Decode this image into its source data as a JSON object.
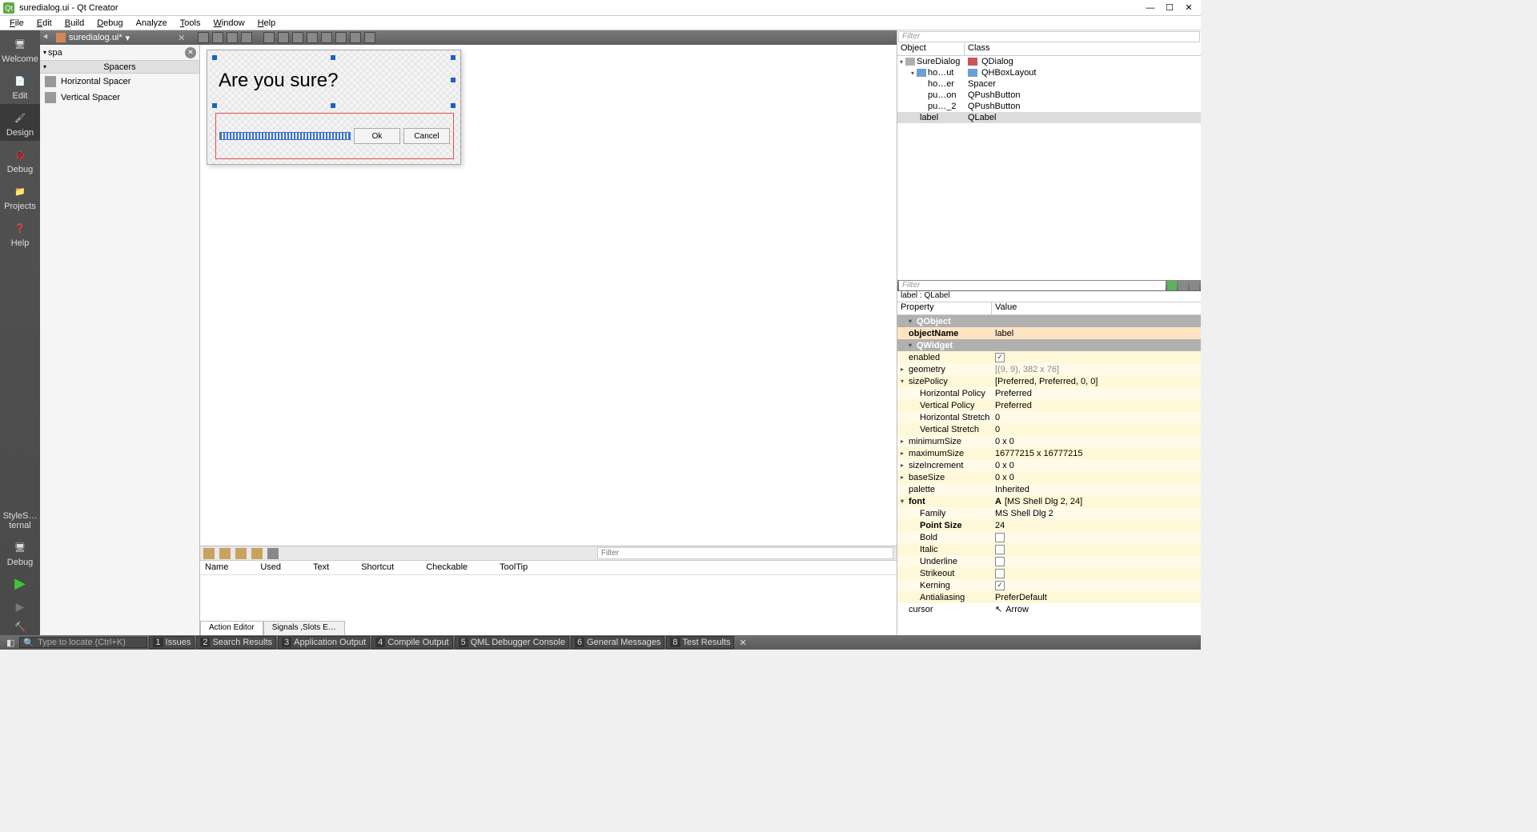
{
  "window": {
    "title": "suredialog.ui - Qt Creator"
  },
  "menu": {
    "file": "File",
    "edit": "Edit",
    "build": "Build",
    "debug": "Debug",
    "analyze": "Analyze",
    "tools": "Tools",
    "window": "Window",
    "help": "Help"
  },
  "doc_tab": {
    "name": "suredialog.ui*"
  },
  "sidebar": {
    "welcome": "Welcome",
    "edit": "Edit",
    "design": "Design",
    "debug": "Debug",
    "projects": "Projects",
    "help": "Help",
    "styles": "StyleS…ternal",
    "debug2": "Debug"
  },
  "widgetbox": {
    "search": "spa",
    "category": "Spacers",
    "items": [
      "Horizontal Spacer",
      "Vertical Spacer"
    ]
  },
  "canvas": {
    "label_text": "Are you sure?",
    "ok": "Ok",
    "cancel": "Cancel"
  },
  "object_tree": {
    "filter_placeholder": "Filter",
    "head_object": "Object",
    "head_class": "Class",
    "rows": [
      {
        "obj": "SureDialog",
        "cls": "QDialog",
        "depth": 0,
        "expand": "v"
      },
      {
        "obj": "ho…ut",
        "cls": "QHBoxLayout",
        "depth": 1,
        "expand": "v"
      },
      {
        "obj": "ho…er",
        "cls": "Spacer",
        "depth": 2,
        "expand": ""
      },
      {
        "obj": "pu…on",
        "cls": "QPushButton",
        "depth": 2,
        "expand": ""
      },
      {
        "obj": "pu…_2",
        "cls": "QPushButton",
        "depth": 2,
        "expand": ""
      },
      {
        "obj": "label",
        "cls": "QLabel",
        "depth": 1,
        "expand": "",
        "selected": true
      }
    ]
  },
  "property_editor": {
    "filter_placeholder": "Filter",
    "selected": "label : QLabel",
    "head_prop": "Property",
    "head_val": "Value",
    "sections": {
      "qobject": "QObject",
      "qwidget": "QWidget"
    },
    "props": {
      "objectName": {
        "label": "objectName",
        "value": "label"
      },
      "enabled": {
        "label": "enabled",
        "checked": true
      },
      "geometry": {
        "label": "geometry",
        "value": "[(9, 9), 382 x 76]"
      },
      "sizePolicy": {
        "label": "sizePolicy",
        "value": "[Preferred, Preferred, 0, 0]"
      },
      "hPolicy": {
        "label": "Horizontal Policy",
        "value": "Preferred"
      },
      "vPolicy": {
        "label": "Vertical Policy",
        "value": "Preferred"
      },
      "hStretch": {
        "label": "Horizontal Stretch",
        "value": "0"
      },
      "vStretch": {
        "label": "Vertical Stretch",
        "value": "0"
      },
      "minimumSize": {
        "label": "minimumSize",
        "value": "0 x 0"
      },
      "maximumSize": {
        "label": "maximumSize",
        "value": "16777215 x 16777215"
      },
      "sizeIncrement": {
        "label": "sizeIncrement",
        "value": "0 x 0"
      },
      "baseSize": {
        "label": "baseSize",
        "value": "0 x 0"
      },
      "palette": {
        "label": "palette",
        "value": "Inherited"
      },
      "font": {
        "label": "font",
        "value": "[MS Shell Dlg 2, 24]"
      },
      "family": {
        "label": "Family",
        "value": "MS Shell Dlg 2"
      },
      "pointSize": {
        "label": "Point Size",
        "value": "24"
      },
      "bold": {
        "label": "Bold",
        "checked": false
      },
      "italic": {
        "label": "Italic",
        "checked": false
      },
      "underline": {
        "label": "Underline",
        "checked": false
      },
      "strikeout": {
        "label": "Strikeout",
        "checked": false
      },
      "kerning": {
        "label": "Kerning",
        "checked": true
      },
      "antialiasing": {
        "label": "Antialiasing",
        "value": "PreferDefault"
      },
      "cursor": {
        "label": "cursor",
        "value": "Arrow"
      }
    }
  },
  "action_editor": {
    "filter_placeholder": "Filter",
    "headers": {
      "name": "Name",
      "used": "Used",
      "text": "Text",
      "shortcut": "Shortcut",
      "checkable": "Checkable",
      "tooltip": "ToolTip"
    },
    "tabs": {
      "action": "Action Editor",
      "signals": "Signals ,Slots E…"
    }
  },
  "status": {
    "locator_placeholder": "Type to locate (Ctrl+K)",
    "tabs": [
      {
        "n": "1",
        "label": "Issues"
      },
      {
        "n": "2",
        "label": "Search Results"
      },
      {
        "n": "3",
        "label": "Application Output"
      },
      {
        "n": "4",
        "label": "Compile Output"
      },
      {
        "n": "5",
        "label": "QML Debugger Console"
      },
      {
        "n": "6",
        "label": "General Messages"
      },
      {
        "n": "8",
        "label": "Test Results"
      }
    ]
  }
}
